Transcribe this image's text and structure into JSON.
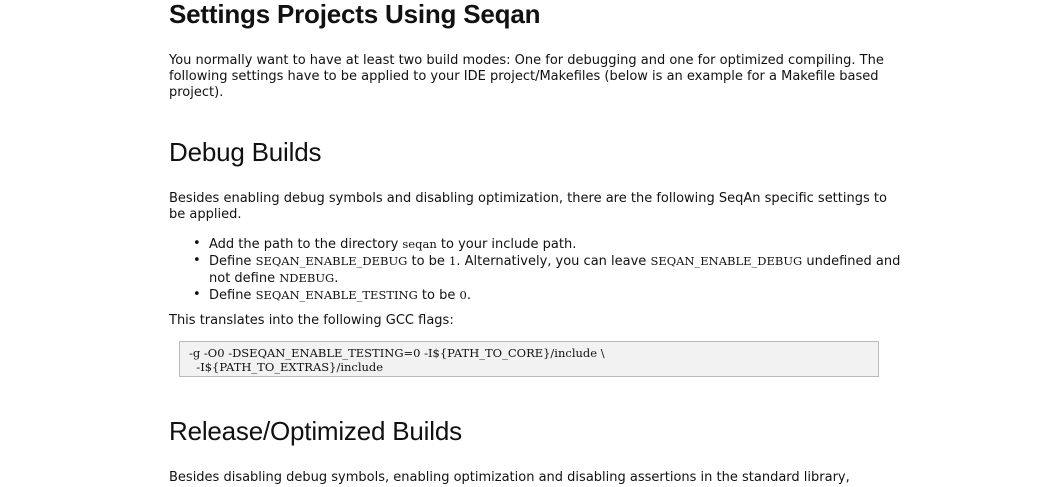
{
  "title": "Settings Projects Using Seqan",
  "intro": "You normally want to have at least two build modes: One for debugging and one for optimized compiling. The following settings have to be applied to your IDE project/Makefiles (below is an example for a Makefile based project).",
  "debug": {
    "heading": "Debug Builds",
    "intro": "Besides enabling debug symbols and disabling optimization, there are the following SeqAn specific settings to be applied.",
    "items": [
      {
        "t1": "Add the path to the directory ",
        "c1": "seqan",
        "t2": " to your include path."
      },
      {
        "t1": "Define ",
        "c1": "SEQAN_ENABLE_DEBUG",
        "t2": " to be ",
        "c2": "1",
        "t3": ". Alternatively, you can leave ",
        "c3": "SEQAN_ENABLE_DEBUG",
        "t4": " undefined and not define ",
        "c4": "NDEBUG",
        "t5": "."
      },
      {
        "t1": "Define ",
        "c1": "SEQAN_ENABLE_TESTING",
        "t2": " to be ",
        "c2": "0",
        "t3": "."
      }
    ],
    "translates": "This translates into the following GCC flags:",
    "code_line1": "-g -O0 -DSEQAN_ENABLE_TESTING=0 -I${PATH_TO_CORE}/include \\",
    "code_line2": "  -I${PATH_TO_EXTRAS}/include"
  },
  "release": {
    "heading": "Release/Optimized Builds",
    "intro": "Besides disabling debug symbols, enabling optimization and disabling assertions in the standard library,"
  }
}
